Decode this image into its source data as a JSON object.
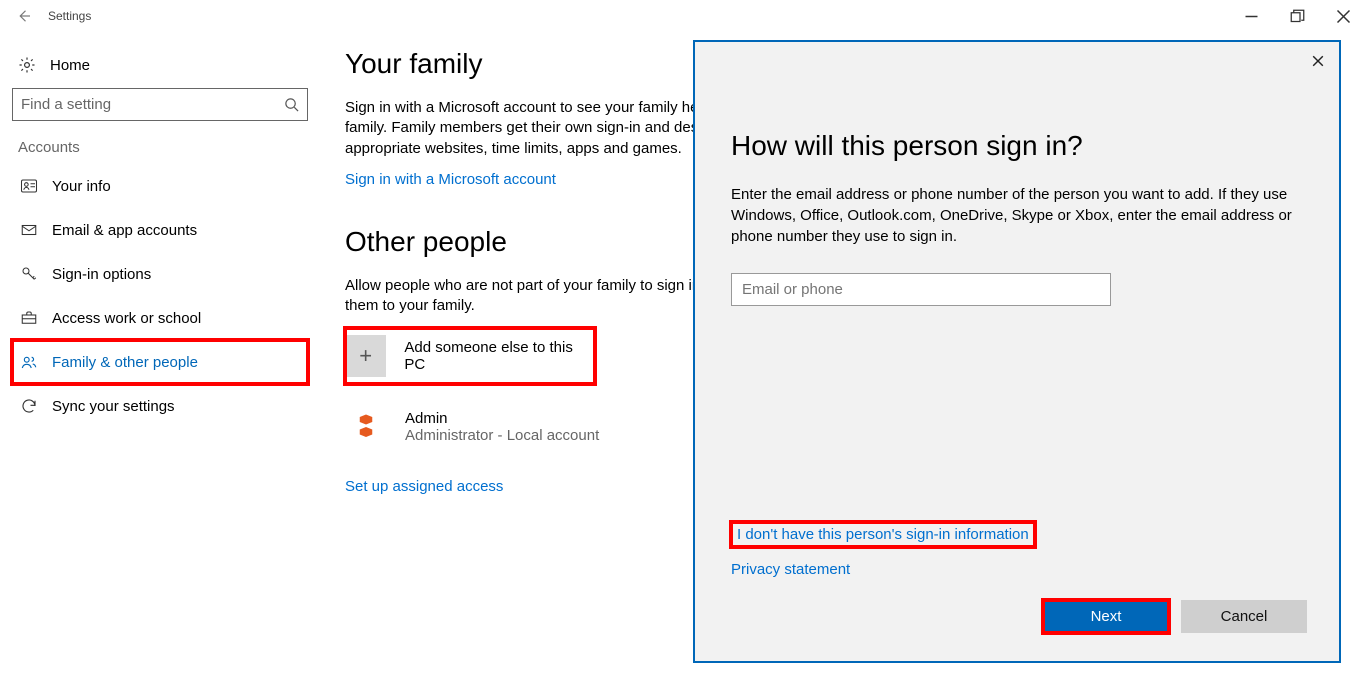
{
  "window": {
    "title": "Settings"
  },
  "sidebar": {
    "home": "Home",
    "search_placeholder": "Find a setting",
    "category": "Accounts",
    "items": [
      {
        "label": "Your info"
      },
      {
        "label": "Email & app accounts"
      },
      {
        "label": "Sign-in options"
      },
      {
        "label": "Access work or school"
      },
      {
        "label": "Family & other people"
      },
      {
        "label": "Sync your settings"
      }
    ]
  },
  "main": {
    "family": {
      "heading": "Your family",
      "body": "Sign in with a Microsoft account to see your family here or add any new members to your family. Family members get their own sign-in and desktop. You can help kids to stay safe with appropriate websites, time limits, apps and games.",
      "sign_in_link": "Sign in with a Microsoft account"
    },
    "other": {
      "heading": "Other people",
      "body": "Allow people who are not part of your family to sign in with their own accounts. This won't add them to your family.",
      "add_label": "Add someone else to this PC",
      "admin_name": "Admin",
      "admin_sub": "Administrator - Local account",
      "assigned_link": "Set up assigned access"
    }
  },
  "dialog": {
    "heading": "How will this person sign in?",
    "body": "Enter the email address or phone number of the person you want to add. If they use Windows, Office, Outlook.com, OneDrive, Skype or Xbox, enter the email address or phone number they use to sign in.",
    "placeholder": "Email or phone",
    "no_info_link": "I don't have this person's sign-in information",
    "privacy_link": "Privacy statement",
    "next": "Next",
    "cancel": "Cancel"
  }
}
